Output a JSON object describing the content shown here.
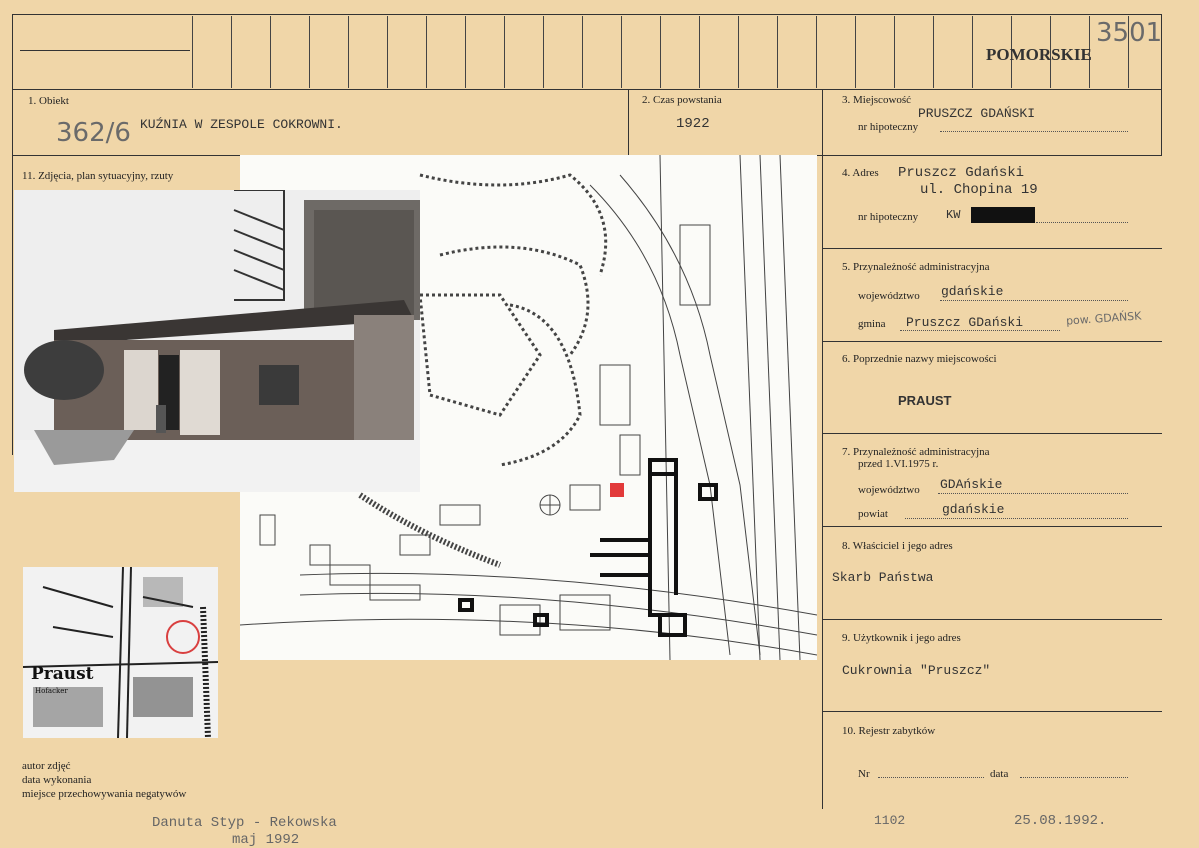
{
  "header": {
    "region": "POMORSKIE",
    "doc_number": "3501"
  },
  "obiekt": {
    "label": "1. Obiekt",
    "value": "KUŹNIA W ZESPOLE COKROWNI.",
    "inventory_number": "362/6"
  },
  "czas": {
    "label": "2. Czas powstania",
    "value": "1922"
  },
  "miejscowosc": {
    "label": "3. Miejscowość",
    "value": "PRUSZCZ  GDAŃSKI",
    "nr_label": "nr  hipoteczny"
  },
  "zdjecia": {
    "label": "11. Zdjęcia, plan sytuacyjny, rzuty"
  },
  "adres": {
    "label": "4. Adres",
    "line1": "Pruszcz Gdański",
    "line2": "ul. Chopina 19",
    "nr_label": "nr  hipoteczny",
    "kw": "KW"
  },
  "przynaleznosc": {
    "label": "5. Przynależność  administracyjna",
    "woj_label": "województwo",
    "woj_value": "gdańskie",
    "gmina_label": "gmina",
    "gmina_value": "Pruszcz GDański",
    "gmina_note": "pow. GDAŃSK"
  },
  "poprzednie": {
    "label": "6. Poprzednie nazwy miejscowości",
    "value": "PRAUST"
  },
  "przed1975": {
    "label": "7. Przynależność  administracyjna",
    "label2": "przed 1.VI.1975 r.",
    "woj_label": "województwo",
    "woj_value": "GDAńskie",
    "powiat_label": "powiat",
    "powiat_value": "gdańskie"
  },
  "wlasciciel": {
    "label": "8. Właściciel i jego adres",
    "value": "Skarb Państwa"
  },
  "uzytkownik": {
    "label": "9. Użytkownik i jego adres",
    "value": "Cukrownia \"Pruszcz\""
  },
  "rejestr": {
    "label": "10. Rejestr  zabytków",
    "nr_label": "Nr",
    "data_label": "data"
  },
  "footer_labels": {
    "autor": "autor  zdjęć",
    "data": "data  wykonania",
    "miejsce": "miejsce  przechowywania  negatywów"
  },
  "footer_values": {
    "author": "Danuta Styp - Rekowska",
    "date_taken": "maj 1992",
    "code": "1102",
    "date": "25.08.1992."
  },
  "map": {
    "town_label": "Praust",
    "town_sub": "Hofacker"
  },
  "colors": {
    "paper": "#f0d6a8",
    "highlight": "#e23a3a",
    "circle": "#d94040"
  }
}
